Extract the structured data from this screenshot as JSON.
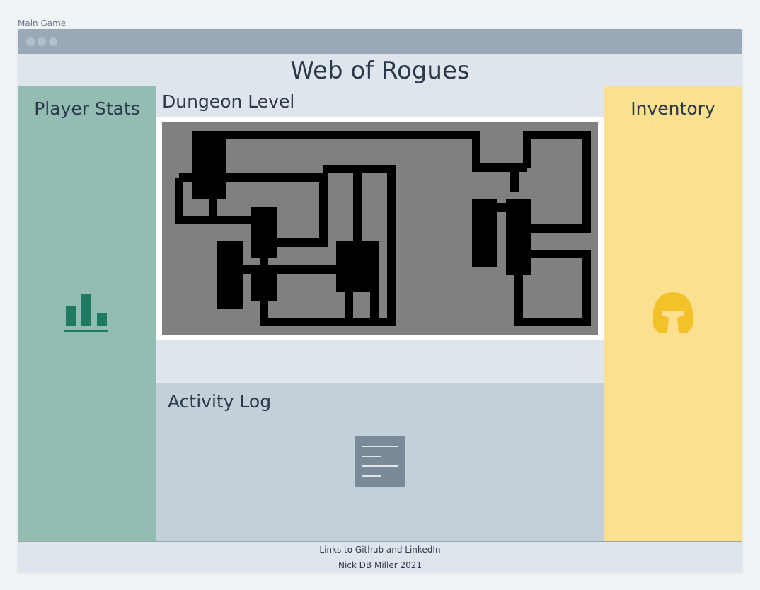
{
  "page_label": "Main Game",
  "game_title": "Web of Rogues",
  "stats_panel": {
    "title": "Player Stats",
    "icon": "bar-chart-icon"
  },
  "dungeon": {
    "title": "Dungeon Level"
  },
  "inventory_panel": {
    "title": "Inventory",
    "icon": "helmet-icon"
  },
  "activity_log": {
    "title": "Activity Log",
    "icon": "document-icon"
  },
  "footer": {
    "links": "Links to Github and LinkedIn",
    "credit": "Nick DB Miller 2021"
  },
  "colors": {
    "stats_bg": "#93bdb2",
    "inventory_bg": "#fae08f",
    "log_bg": "#c3d0d9",
    "map_floor": "#808080",
    "map_wall": "#000000",
    "stats_icon": "#1f7a63",
    "inventory_icon": "#f3c128",
    "log_icon": "#7b8a98"
  }
}
